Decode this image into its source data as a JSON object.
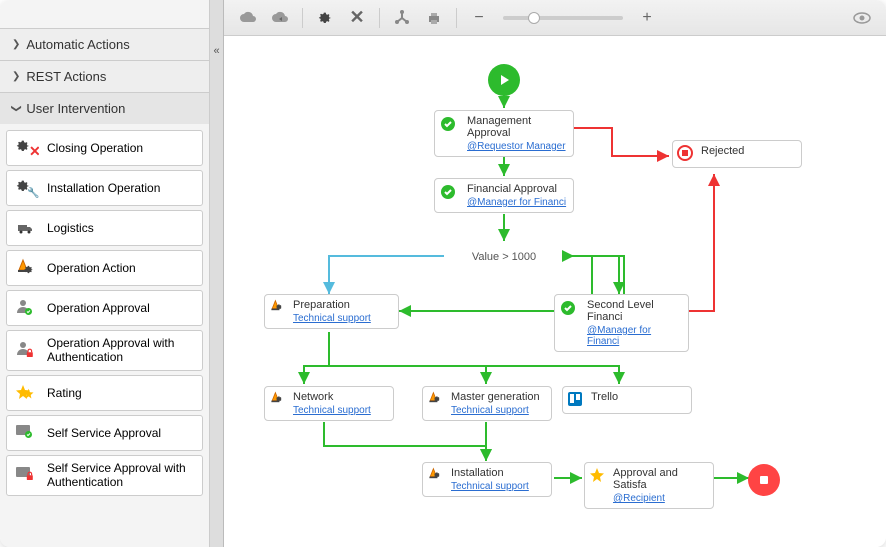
{
  "palette": {
    "sections": [
      {
        "name": "Automatic Actions",
        "open": false
      },
      {
        "name": "REST Actions",
        "open": false
      },
      {
        "name": "User Intervention",
        "open": true
      }
    ],
    "items": [
      "Closing Operation",
      "Installation Operation",
      "Logistics",
      "Operation Action",
      "Operation Approval",
      "Operation Approval with Authentication",
      "Rating",
      "Self Service Approval",
      "Self Service Approval with Authentication"
    ]
  },
  "canvas": {
    "decision_label": "Value > 1000",
    "nodes": {
      "management": {
        "title": "Management Approval",
        "sub": "@Requestor Manager"
      },
      "financial": {
        "title": "Financial Approval",
        "sub": "@Manager for Financi"
      },
      "second": {
        "title": "Second Level Financi",
        "sub": "@Manager for Financi"
      },
      "rejected": {
        "title": "Rejected"
      },
      "preparation": {
        "title": "Preparation",
        "sub": "Technical support"
      },
      "network": {
        "title": "Network",
        "sub": "Technical support"
      },
      "master": {
        "title": "Master generation",
        "sub": "Technical support"
      },
      "trello": {
        "title": "Trello"
      },
      "installation": {
        "title": "Installation",
        "sub": "Technical support"
      },
      "approval": {
        "title": "Approval and Satisfa",
        "sub": "@Recipient"
      }
    }
  },
  "chart_data": {
    "type": "flowchart",
    "title": "",
    "nodes": [
      {
        "id": "start",
        "type": "start"
      },
      {
        "id": "management",
        "type": "task",
        "title": "Management Approval",
        "assignee": "@Requestor Manager"
      },
      {
        "id": "financial",
        "type": "task",
        "title": "Financial Approval",
        "assignee": "@Manager for Financi"
      },
      {
        "id": "rejected",
        "type": "task",
        "title": "Rejected"
      },
      {
        "id": "decision",
        "type": "decision",
        "label": "Value > 1000"
      },
      {
        "id": "second",
        "type": "task",
        "title": "Second Level Financi",
        "assignee": "@Manager for Financi"
      },
      {
        "id": "preparation",
        "type": "task",
        "title": "Preparation",
        "assignee": "Technical support"
      },
      {
        "id": "network",
        "type": "task",
        "title": "Network",
        "assignee": "Technical support"
      },
      {
        "id": "master",
        "type": "task",
        "title": "Master generation",
        "assignee": "Technical support"
      },
      {
        "id": "trello",
        "type": "task",
        "title": "Trello"
      },
      {
        "id": "installation",
        "type": "task",
        "title": "Installation",
        "assignee": "Technical support"
      },
      {
        "id": "approval",
        "type": "task",
        "title": "Approval and Satisfa",
        "assignee": "@Recipient"
      },
      {
        "id": "end",
        "type": "end"
      }
    ],
    "edges": [
      {
        "from": "start",
        "to": "management",
        "color": "green"
      },
      {
        "from": "management",
        "to": "financial",
        "color": "green"
      },
      {
        "from": "management",
        "to": "rejected",
        "color": "red"
      },
      {
        "from": "financial",
        "to": "decision",
        "color": "green"
      },
      {
        "from": "decision",
        "to": "second",
        "color": "green"
      },
      {
        "from": "decision",
        "to": "preparation",
        "color": "blue"
      },
      {
        "from": "second",
        "to": "preparation",
        "color": "green"
      },
      {
        "from": "second",
        "to": "rejected",
        "color": "red"
      },
      {
        "from": "preparation",
        "to": "network",
        "color": "green"
      },
      {
        "from": "preparation",
        "to": "master",
        "color": "green"
      },
      {
        "from": "preparation",
        "to": "trello",
        "color": "green"
      },
      {
        "from": "network",
        "to": "installation",
        "color": "green"
      },
      {
        "from": "master",
        "to": "installation",
        "color": "green"
      },
      {
        "from": "installation",
        "to": "approval",
        "color": "green"
      },
      {
        "from": "approval",
        "to": "end",
        "color": "green"
      }
    ]
  }
}
